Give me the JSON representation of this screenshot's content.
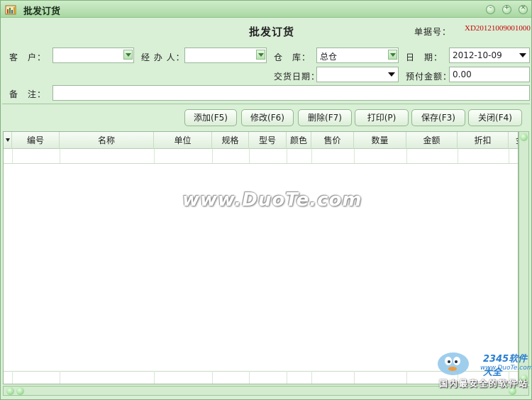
{
  "window": {
    "title": "批发订货",
    "controls": [
      "minimize",
      "maximize",
      "close"
    ]
  },
  "form": {
    "heading": "批发订货",
    "doc_no_label": "单据号：",
    "doc_no_value": "XD20121009001000",
    "customer_label": "客　户：",
    "customer_value": "",
    "agent_label": "经 办 人：",
    "agent_value": "",
    "warehouse_label": "仓　库：",
    "warehouse_value": "总仓",
    "date_label": "日　期：",
    "date_value": "2012-10-09",
    "delivery_date_label": "交货日期：",
    "delivery_date_value": "",
    "prepay_label": "预付金额：",
    "prepay_value": "0.00",
    "remark_label": "备　注：",
    "remark_value": ""
  },
  "toolbar": {
    "add": "添加(F5)",
    "edit": "修改(F6)",
    "delete": "删除(F7)",
    "print": "打印(P)",
    "save": "保存(F3)",
    "close": "关闭(F4)"
  },
  "table": {
    "columns": [
      "编号",
      "名称",
      "单位",
      "规格",
      "型号",
      "颜色",
      "售价",
      "数量",
      "金额",
      "折扣",
      "金"
    ]
  },
  "watermark": {
    "text": "www.DuoTe.com",
    "brand": "2345软件大全",
    "url": "www.DuoTe.com",
    "slogan": "国内最安全的软件站"
  },
  "colors": {
    "window_bg": "#d9efd6",
    "title_bar": "#a9d8a3",
    "doc_no": "#c40000"
  }
}
